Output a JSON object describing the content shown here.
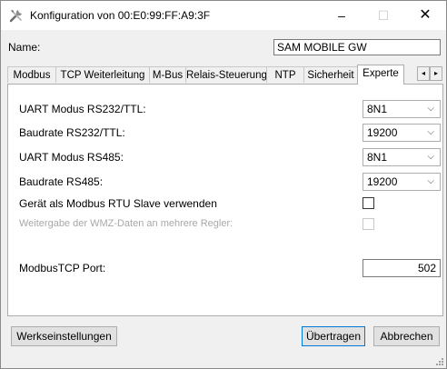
{
  "window": {
    "title": "Konfiguration von 00:E0:99:FF:A9:3F",
    "minimize": "–",
    "maximize": "☐",
    "close": "✕"
  },
  "name_field": {
    "label": "Name:",
    "value": "SAM MOBILE GW"
  },
  "tabs": [
    {
      "label": "Modbus"
    },
    {
      "label": "TCP Weiterleitung"
    },
    {
      "label": "M-Bus"
    },
    {
      "label": "Relais-Steuerung"
    },
    {
      "label": "NTP"
    },
    {
      "label": "Sicherheit"
    },
    {
      "label": "Experte",
      "active": true
    }
  ],
  "tab_scroll": {
    "left": "◂",
    "right": "▸"
  },
  "settings": {
    "uart_mode_232": {
      "label": "UART Modus RS232/TTL:",
      "value": "8N1"
    },
    "baud_232": {
      "label": "Baudrate RS232/TTL:",
      "value": "19200"
    },
    "uart_mode_485": {
      "label": "UART Modus RS485:",
      "value": "8N1"
    },
    "baud_485": {
      "label": "Baudrate RS485:",
      "value": "19200"
    },
    "modbus_rtu_slave": {
      "label": "Gerät als Modbus RTU Slave verwenden",
      "checked": false
    },
    "wmz_forward": {
      "label": "Weitergabe der WMZ-Daten an mehrere Regler:",
      "checked": false,
      "disabled": true
    },
    "modbus_tcp_port": {
      "label": "ModbusTCP Port:",
      "value": "502"
    }
  },
  "chevron": "⌵",
  "buttons": {
    "reset": "Werkseinstellungen",
    "transfer": "Übertragen",
    "cancel": "Abbrechen"
  }
}
